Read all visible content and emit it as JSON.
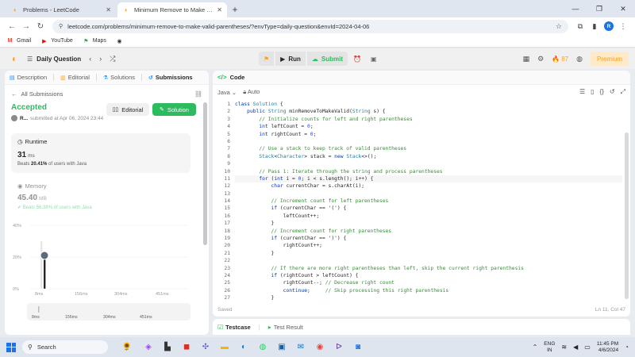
{
  "browser": {
    "tabs": [
      {
        "title": "Problems - LeetCode",
        "active": false
      },
      {
        "title": "Minimum Remove to Make Valid Parentheses",
        "active": true
      }
    ],
    "url": "leetcode.com/problems/minimum-remove-to-make-valid-parentheses/?envType=daily-question&envId=2024-04-06",
    "profile_initial": "R",
    "bookmarks": [
      "Gmail",
      "YouTube",
      "Maps"
    ]
  },
  "header": {
    "daily_question": "Daily Question",
    "run_label": "Run",
    "submit_label": "Submit",
    "streak": "87",
    "premium_label": "Premium"
  },
  "left": {
    "tabs": [
      "Description",
      "Editorial",
      "Solutions",
      "Submissions"
    ],
    "all_submissions": "All Submissions",
    "status": "Accepted",
    "user": "R...",
    "submitted_at": "submitted at Apr 06, 2024 23:44",
    "editorial_btn": "Editorial",
    "solution_btn": "Solution",
    "runtime": {
      "label": "Runtime",
      "value": "31",
      "unit": "ms",
      "beats_pct": "20.41%",
      "beats_text": "of users with Java"
    },
    "memory": {
      "label": "Memory",
      "value": "45.40",
      "unit": "MB",
      "beats_pct": "56.38%",
      "beats_text": "of users with Java"
    }
  },
  "chart_data": {
    "type": "bar",
    "title": "",
    "xlabel": "",
    "ylabel": "",
    "y_ticks": [
      "40%",
      "20%",
      "0%"
    ],
    "x_ticks": [
      "8ms",
      "156ms",
      "304ms",
      "451ms"
    ],
    "mini_x_ticks": [
      "8ms",
      "156ms",
      "304ms",
      "451ms"
    ],
    "ylim": [
      0,
      40
    ],
    "categories": [
      "8ms",
      "31ms"
    ],
    "values": [
      30,
      20
    ]
  },
  "code": {
    "title": "Code",
    "language": "Java",
    "mode": "Auto",
    "status": "Saved",
    "cursor": "Ln 11, Col 47",
    "lines": [
      "class Solution {",
      "    public String minRemoveToMakeValid(String s) {",
      "        // Initialize counts for left and right parentheses",
      "        int leftCount = 0;",
      "        int rightCount = 0;",
      "",
      "        // Use a stack to keep track of valid parentheses",
      "        Stack<Character> stack = new Stack<>();",
      "",
      "        // Pass 1: Iterate through the string and process parentheses",
      "        for (int i = 0; i < s.length(); i++) {",
      "            char currentChar = s.charAt(i);",
      "",
      "            // Increment count for left parentheses",
      "            if (currentChar == '(') {",
      "                leftCount++;",
      "            }",
      "            // Increment count for right parentheses",
      "            if (currentChar == ')') {",
      "                rightCount++;",
      "            }",
      "",
      "            // If there are more right parentheses than left, skip the current right parenthesis",
      "            if (rightCount > leftCount) {",
      "                rightCount--; // Decrease right count",
      "                continue;     // Skip processing this right parenthesis",
      "            }"
    ]
  },
  "testcase": {
    "tab1": "Testcase",
    "tab2": "Test Result"
  },
  "taskbar": {
    "search": "Search",
    "lang_top": "ENG",
    "lang_bottom": "IN",
    "time": "11:45 PM",
    "date": "4/6/2024"
  }
}
